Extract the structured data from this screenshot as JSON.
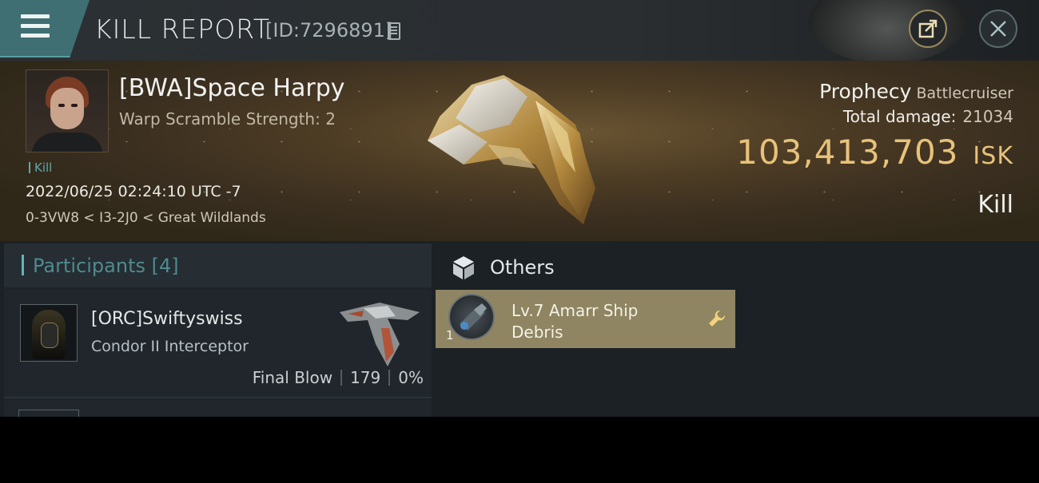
{
  "header": {
    "title": "KILL REPORT",
    "report_id": "[ID:7296891]"
  },
  "victim": {
    "name": "[BWA]Space Harpy",
    "warp_scramble": "Warp Scramble Strength: 2",
    "tag": "Kill",
    "timestamp": "2022/06/25 02:24:10 UTC -7",
    "location": "0-3VW8 < I3-2J0 < Great Wildlands",
    "ship_name": "Prophecy",
    "ship_class": "Battlecruiser",
    "total_damage_label": "Total damage:",
    "total_damage_value": "21034",
    "isk_value": "103,413,703",
    "isk_unit": "ISK",
    "result": "Kill"
  },
  "participants": {
    "title": "Participants [4]",
    "rows": [
      {
        "name": "[ORC]Swiftyswiss",
        "ship": "Condor II Interceptor",
        "final_blow": "Final Blow",
        "damage": "179",
        "percent": "0%"
      }
    ]
  },
  "others": {
    "title": "Others",
    "items": [
      {
        "qty": "1",
        "name": "Lv.7 Amarr Ship Debris"
      }
    ]
  },
  "colors": {
    "accent_teal": "#5fb6b6",
    "isk_gold": "#e8c27a",
    "item_card": "#8f8562"
  },
  "icons": [
    "menu-icon",
    "copy-icon",
    "share-icon",
    "close-icon",
    "cube-icon",
    "wrench-icon"
  ]
}
